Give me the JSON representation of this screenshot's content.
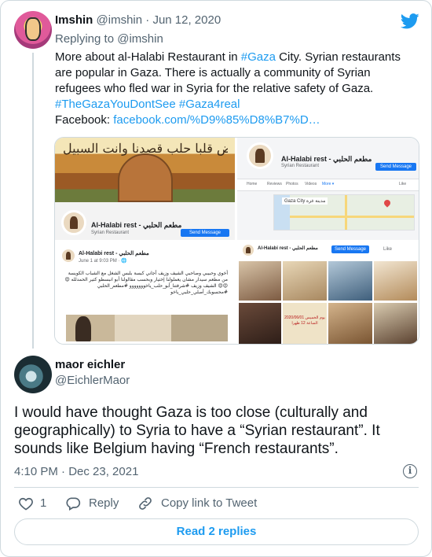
{
  "tweet": {
    "author_name": "Imshin",
    "author_handle": "@imshin",
    "separator": "·",
    "date": "Jun 12, 2020",
    "replying_to": "Replying to @imshin",
    "text_1": "More about al-Halabi Restaurant in ",
    "hashtag_gaza": "#Gaza",
    "text_2": " City. Syrian restaurants are popular in Gaza. There is actually a community of Syrian refugees who fled war in Syria for the relative safety of Gaza.",
    "hashtag_1": "#TheGazaYouDontSee",
    "hashtag_2": "#Gaza4real",
    "facebook_label": "Facebook: ",
    "facebook_link": "facebook.com/%D9%85%D8%B7%D…",
    "media": {
      "cover_script": "حبيت الروض قلبا حلب قصدنا وانت السبيل",
      "page_name": "Al-Halabi rest - مطعم الحلبي",
      "page_category": "Syrian Restaurant",
      "send_message": "Send Message",
      "nav_items": [
        "Home",
        "Reviews",
        "Photos",
        "Videos",
        "More ▾"
      ],
      "like": "Like",
      "map_label": "Gaza City مدينة غزة",
      "post_author": "Al-Halabi rest - مطعم الحلبي",
      "post_time": "June 1 at 9:03 PM · 🌐",
      "post_text": "أخوي وحبيبي وصاحبي الشيف وزيف أجاني كبسة بلبس الشغل مع الشباب الكويسة من مطعم سيدار مشان يعملولنا إختيار وبحسب مقالولنا أبو انبسطو كتير الحمدلله 😍😍😍 الشيف وزيف #شرفتنا_أبو_حلب_ياخووووووو #مطعم_الحلبي #محسوبك_أصلي_حلبي_ياخو",
      "photos_sign": "يوم الخميس 2020/06/01 الساعة 12 ظهرا"
    }
  },
  "reply": {
    "author_name": "maor eichler",
    "author_handle": "@EichlerMaor",
    "text": "I would have thought Gaza is too close (culturally and geographically) to Syria to have a “Syrian restaurant”. It sounds like Belgium having “French restaurants”.",
    "timestamp": "4:10 PM · Dec 23, 2021"
  },
  "actions": {
    "like_count": "1",
    "reply_label": "Reply",
    "copy_link_label": "Copy link to Tweet",
    "read_replies": "Read 2 replies"
  },
  "colors": {
    "accent": "#1d9bf0",
    "text_primary": "#0f1419",
    "text_muted": "#536471",
    "border": "#cfd9de",
    "facebook_blue": "#1877f2"
  },
  "icons": [
    "twitter-bird-icon",
    "info-icon",
    "heart-icon",
    "reply-bubble-icon",
    "link-icon"
  ]
}
